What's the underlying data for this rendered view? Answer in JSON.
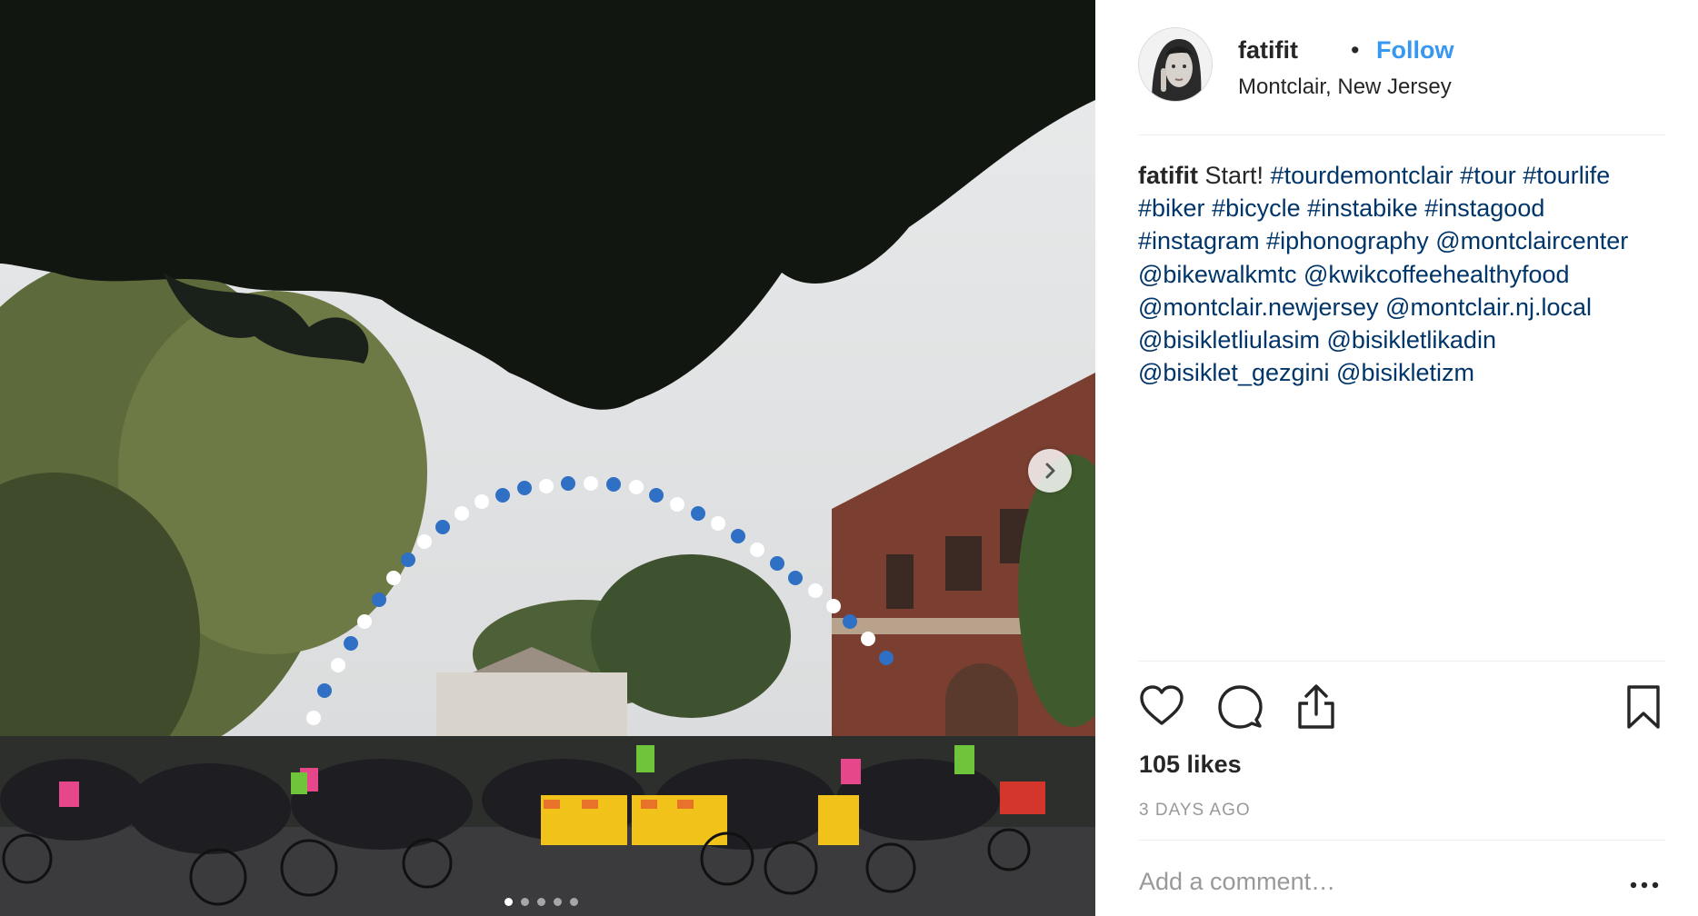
{
  "post": {
    "username": "fatifit",
    "bullet": "•",
    "follow_label": "Follow",
    "location": "Montclair, New Jersey",
    "caption": {
      "username": "fatifit",
      "text": "Start!",
      "tags": [
        "#tourdemontclair",
        "#tour",
        "#tourlife",
        "#biker",
        "#bicycle",
        "#instabike",
        "#instagood",
        "#instagram",
        "#iphonography",
        "@montclaircenter",
        "@bikewalkmtc",
        "@kwikcoffeehealthyfood",
        "@montclair.newjersey",
        "@montclair.nj.local",
        "@bisikletliulasim",
        "@bisikletlikadin",
        "@bisiklet_gezgini",
        "@bisikletizm"
      ]
    },
    "likes": "105 likes",
    "timestamp": "3 DAYS AGO",
    "comment_placeholder": "Add a comment…",
    "carousel": {
      "slide_count": 5,
      "active_index": 0
    }
  },
  "icons": {
    "like": "heart-icon",
    "comment": "comment-bubble-icon",
    "share": "share-icon",
    "save": "bookmark-icon",
    "next": "chevron-right-icon",
    "more": "more-horizontal-icon"
  },
  "colors": {
    "link": "#3897f0",
    "hashtag": "#003569",
    "muted": "#999999",
    "text": "#262626",
    "divider": "#efefef"
  }
}
